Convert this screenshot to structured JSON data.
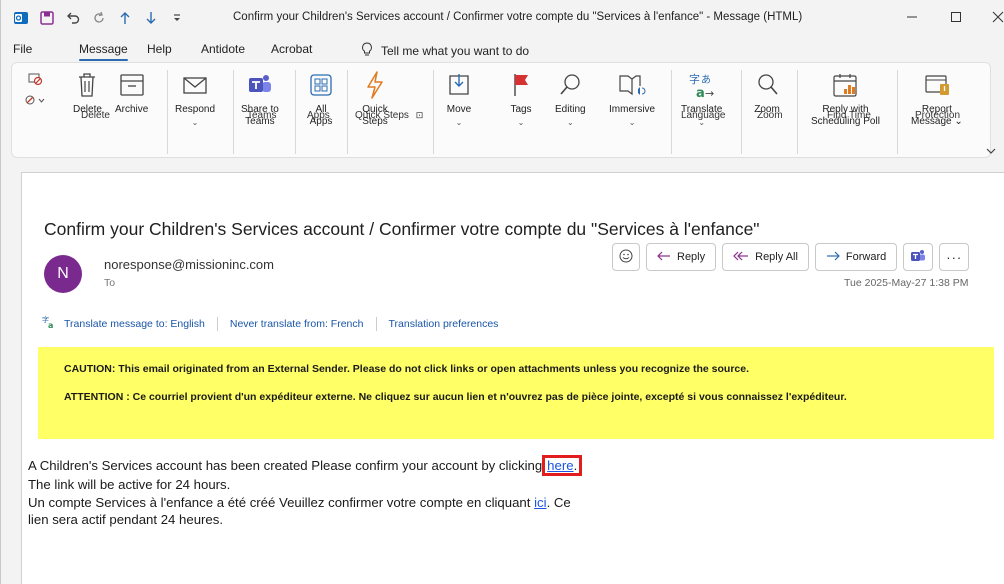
{
  "window": {
    "title": "Confirm your Children's Services account / Confirmer votre compte du \"Services à l'enfance\"  -  Message (HTML)"
  },
  "menu": {
    "tabs": [
      "File",
      "Message",
      "Help",
      "Antidote",
      "Acrobat"
    ],
    "active": "Message",
    "tell_me": "Tell me what you want to do"
  },
  "ribbon": {
    "buttons": {
      "delete": "Delete",
      "archive": "Archive",
      "respond": "Respond",
      "share_teams_1": "Share to",
      "share_teams_2": "Teams",
      "all_apps_1": "All",
      "all_apps_2": "Apps",
      "quick_steps_1": "Quick",
      "quick_steps_2": "Steps",
      "move": "Move",
      "tags": "Tags",
      "editing": "Editing",
      "immersive": "Immersive",
      "translate": "Translate",
      "zoom": "Zoom",
      "reply_poll_1": "Reply with",
      "reply_poll_2": "Scheduling Poll",
      "report_1": "Report",
      "report_2": "Message"
    },
    "groups": {
      "delete": "Delete",
      "teams": "Teams",
      "apps": "Apps",
      "quick_steps": "Quick Steps",
      "language": "Language",
      "zoom": "Zoom",
      "find_time": "Find Time",
      "protection": "Protection"
    }
  },
  "message": {
    "subject": "Confirm your Children's Services account / Confirmer votre compte du \"Services à l'enfance\"",
    "avatar_initial": "N",
    "sender": "noresponse@missioninc.com",
    "to_label": "To",
    "date": "Tue 2025-May-27 1:38 PM",
    "actions": {
      "reply": "Reply",
      "reply_all": "Reply All",
      "forward": "Forward"
    },
    "translate": {
      "translate_to": "Translate message to: English",
      "never_translate": "Never translate from: French",
      "preferences": "Translation preferences"
    },
    "caution": {
      "en": "CAUTION: This email originated from an External Sender. Please do not click links or open attachments unless you recognize the source.",
      "fr": "ATTENTION : Ce courriel provient d'un expéditeur externe. Ne cliquez sur aucun lien et n'ouvrez pas de pièce jointe, excepté si vous connaissez l'expéditeur."
    },
    "body": {
      "line1_prefix": "A Children's Services account has been created  Please confirm your account by clicking",
      "link_here": "here",
      "line1_suffix": ".",
      "line2": "The link will be active for 24 hours.",
      "line3_prefix": "Un compte Services à l'enfance a été créé Veuillez confirmer votre compte en cliquant ",
      "link_ici": "ici",
      "line3_suffix": ". Ce",
      "line4": "lien sera actif pendant 24 heures."
    }
  },
  "colors": {
    "avatar": "#7a2a8f",
    "caution_bg": "#ffff66",
    "link": "#1a56e0",
    "highlight_border": "#e21d1d",
    "accent": "#2b6cb0"
  }
}
